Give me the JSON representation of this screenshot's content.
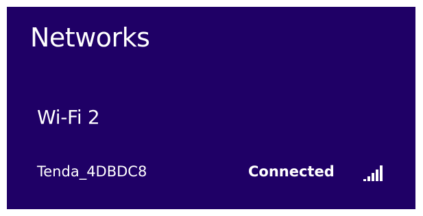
{
  "panel": {
    "title": "Networks",
    "section_label": "Wi-Fi 2",
    "networks": [
      {
        "name": "Tenda_4DBDC8",
        "status": "Connected",
        "signal_icon": "wifi-signal-icon",
        "signal_bars": 5,
        "signal_max": 5
      }
    ]
  },
  "colors": {
    "panel_background": "#1f0066",
    "text": "#ffffff"
  }
}
